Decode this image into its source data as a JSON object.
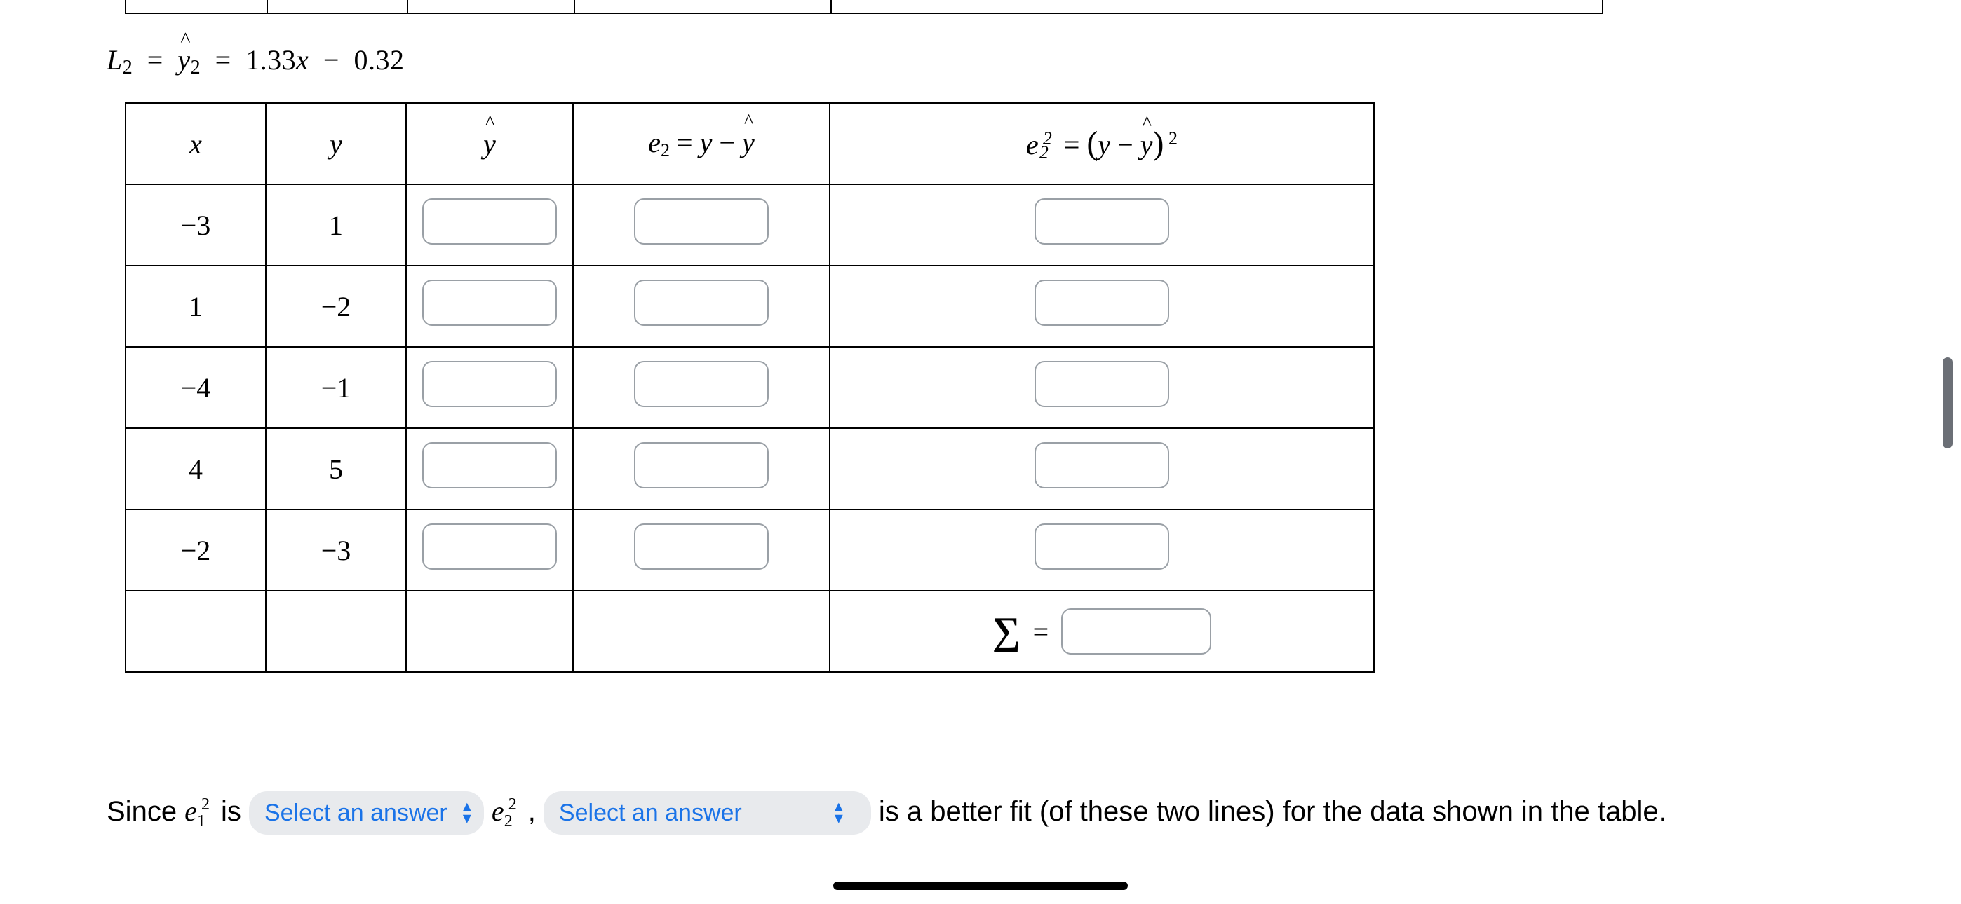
{
  "equation": {
    "lhs": "L",
    "lhs_sub": "2",
    "eq1": "=",
    "yhat": "y",
    "yhat_sub": "2",
    "eq2": "=",
    "slope": "1.33",
    "xvar": "x",
    "minus": "−",
    "intercept": "0.32"
  },
  "headers": {
    "x": "x",
    "y": "y",
    "yhat": "ŷ",
    "e2_pre": "e",
    "e2_sub": "2",
    "e2_mid": " = ",
    "e2_yvar": "y",
    "e2_minus": " − ",
    "e2_yhat": "ŷ",
    "e2sq_pre": "e",
    "e2sq_sub": "2",
    "e2sq_sup": "2",
    "e2sq_eq": " = ",
    "e2sq_open": "(",
    "e2sq_y": "y",
    "e2sq_minus": " − ",
    "e2sq_yhat": "ŷ",
    "e2sq_close": ")",
    "e2sq_pow": " 2"
  },
  "rows": [
    {
      "x": "−3",
      "y": "1"
    },
    {
      "x": "1",
      "y": "−2"
    },
    {
      "x": "−4",
      "y": "−1"
    },
    {
      "x": "4",
      "y": "5"
    },
    {
      "x": "−2",
      "y": "−3"
    }
  ],
  "sigma": {
    "sym": "∑",
    "eq": "="
  },
  "sentence": {
    "s1": "Since ",
    "e1_e": "e",
    "e1_sub": "1",
    "e1_sup": "2",
    "s_is": " is ",
    "sel_placeholder": "Select an answer",
    "s_sp1": " ",
    "e2_e": "e",
    "e2_sub": "2",
    "e2_sup": "2",
    "s_comma": " , ",
    "s_sp2": " ",
    "s_rest": " is a better fit (of these two lines) for the data shown in the table."
  }
}
